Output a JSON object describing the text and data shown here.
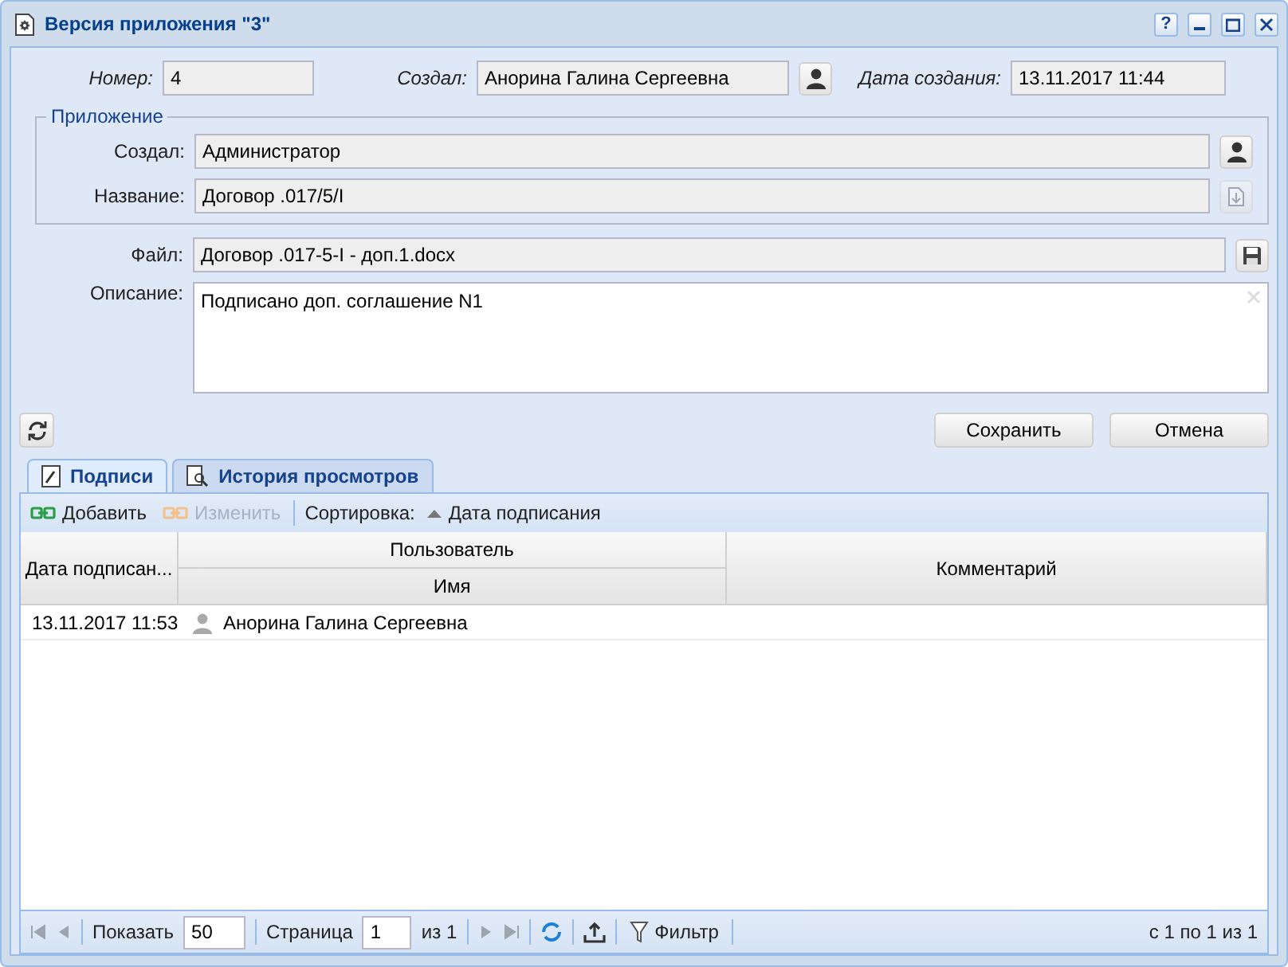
{
  "window": {
    "title": "Версия приложения \"3\"",
    "buttons": [
      {
        "kind": "help",
        "label": "?"
      }
    ]
  },
  "header_fields": [
    {
      "label": "Номер:",
      "value": "4",
      "kind": "text"
    },
    {
      "label": "Создал:",
      "value": "Анорина Галина Сергеевна",
      "kind": "user"
    },
    {
      "label": "Дата создания:",
      "value": "13.11.2017 11:44",
      "kind": "text"
    }
  ],
  "application": {
    "legend": "Приложение",
    "fields": [
      {
        "label": "Создал:",
        "value": "Администратор",
        "kind": "user",
        "disabled": false
      },
      {
        "label": "Название:",
        "value": "Договор .017/5/I",
        "kind": "download",
        "disabled": true
      }
    ]
  },
  "file": {
    "label": "Файл:",
    "value": "Договор .017-5-I - доп.1.docx"
  },
  "description": {
    "label": "Описание:",
    "value": "Подписано доп. соглашение N1"
  },
  "actions": [
    {
      "label": "Сохранить"
    },
    {
      "label": "Отмена"
    }
  ],
  "tabs": [
    {
      "label": "Подписи",
      "selected": true,
      "kind": "sign"
    },
    {
      "label": "История просмотров",
      "selected": false,
      "kind": "history"
    }
  ],
  "toolbar": {
    "buttons": [
      {
        "label": "Добавить",
        "disabled": false
      },
      {
        "label": "Изменить",
        "disabled": true
      }
    ],
    "sort_label": "Сортировка:",
    "sort_field": "Дата подписания"
  },
  "table": {
    "columns": [
      {
        "label": "Дата подписан..."
      },
      {
        "label": "Пользователь",
        "sub": "Имя"
      },
      {
        "label": "Комментарий"
      }
    ],
    "rows": [
      {
        "date": "13.11.2017 11:53",
        "user": "Анорина Галина Сергеевна"
      }
    ]
  },
  "pager": {
    "show_label": "Показать",
    "page_size": "50",
    "page_label": "Страница",
    "page": "1",
    "of": "из 1",
    "filter": "Фильтр",
    "summary": "с 1 по 1 из 1"
  }
}
